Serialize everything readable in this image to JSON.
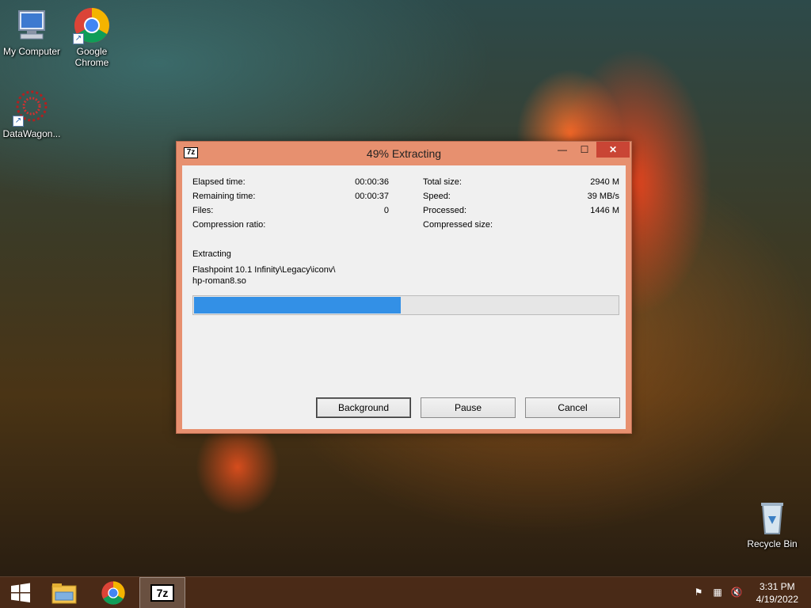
{
  "desktop": {
    "icons": [
      {
        "label": "My Computer"
      },
      {
        "label": "Google Chrome"
      },
      {
        "label": "DataWagon..."
      },
      {
        "label": "Recycle Bin"
      }
    ]
  },
  "dialog": {
    "app_icon_text": "7z",
    "title": "49% Extracting",
    "window_buttons": {
      "minimize": "—",
      "maximize": "☐",
      "close": "✕"
    },
    "stats_left": [
      {
        "label": "Elapsed time:",
        "value": "00:00:36"
      },
      {
        "label": "Remaining time:",
        "value": "00:00:37"
      },
      {
        "label": "Files:",
        "value": "0"
      },
      {
        "label": "Compression ratio:",
        "value": ""
      }
    ],
    "stats_right": [
      {
        "label": "Total size:",
        "value": "2940 M"
      },
      {
        "label": "Speed:",
        "value": "39 MB/s"
      },
      {
        "label": "Processed:",
        "value": "1446 M"
      },
      {
        "label": "Compressed size:",
        "value": ""
      }
    ],
    "operation": "Extracting",
    "current_file_line1": "Flashpoint 10.1 Infinity\\Legacy\\iconv\\",
    "current_file_line2": "hp-roman8.so",
    "progress": 0.49,
    "progress_color": "#3390e6",
    "buttons": {
      "background": "Background",
      "pause": "Pause",
      "cancel": "Cancel"
    }
  },
  "taskbar": {
    "apps": [
      {
        "name": "start-icon"
      },
      {
        "name": "file-explorer-icon"
      },
      {
        "name": "chrome-icon"
      },
      {
        "name": "7zip-icon",
        "text": "7z"
      }
    ],
    "clock_time": "3:31 PM",
    "clock_date": "4/19/2022"
  }
}
